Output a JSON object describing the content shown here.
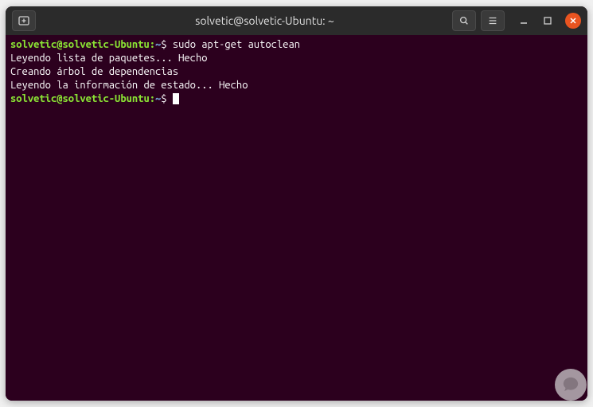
{
  "window": {
    "title": "solvetic@solvetic-Ubuntu: ~"
  },
  "terminal": {
    "prompt": {
      "userhost": "solvetic@solvetic-Ubuntu",
      "separator": ":",
      "path": "~",
      "symbol": "$"
    },
    "command": "sudo apt-get autoclean",
    "output": [
      "Leyendo lista de paquetes... Hecho",
      "Creando árbol de dependencias",
      "Leyendo la información de estado... Hecho"
    ]
  }
}
